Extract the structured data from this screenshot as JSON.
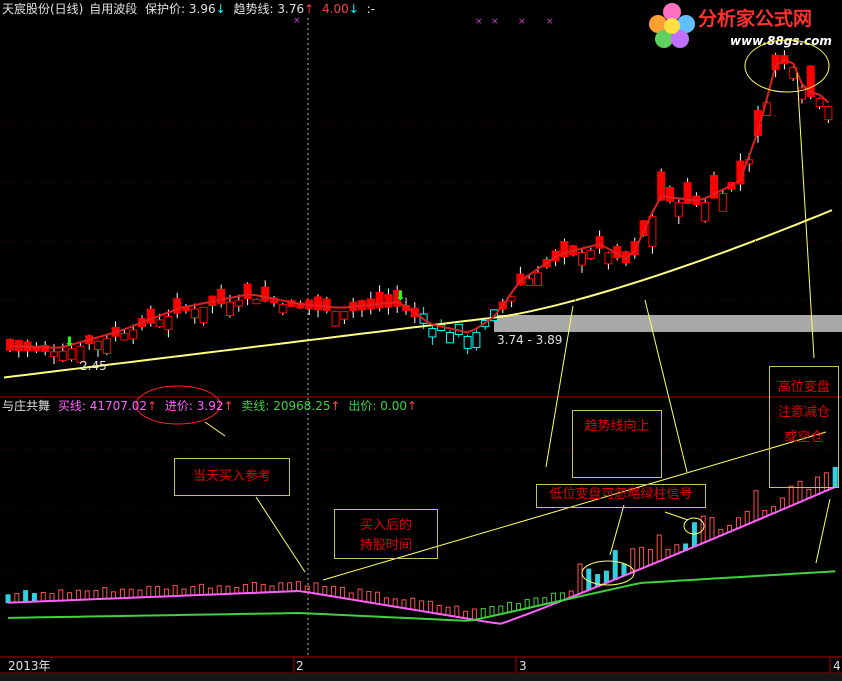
{
  "header": {
    "title": "天宸股份(日线)",
    "indicator_name": "自用波段",
    "protect_label": "保护价:",
    "protect_value": "3.96",
    "trend_label": "趋势线:",
    "trend_value": "3.76",
    "extra_value": "4.00",
    "extra_suffix": ":-"
  },
  "price_panel": {
    "min_label": "2.45",
    "range_label": "3.74 - 3.89"
  },
  "sub_header": {
    "name": "与庄共舞",
    "buy_label": "买线:",
    "buy_value": "41707.02",
    "enter_label": "进价:",
    "enter_value": "3.92",
    "sell_label": "卖线:",
    "sell_value": "20968.25",
    "exit_label": "出价:",
    "exit_value": "0.00"
  },
  "x_axis": {
    "year_label": "2013年",
    "month2": "2",
    "month3": "3",
    "month4": "4"
  },
  "annotations": {
    "buy_ref": "当天买入参考",
    "hold_line1": "买入后的",
    "hold_line2": "持股时间",
    "trend_up": "趋势线向上",
    "low_change": "低位变盘可忽略绿柱信号",
    "high_line1": "高位变盘",
    "high_line2": "注意减仓",
    "high_line3": "或空仓"
  },
  "logo": {
    "name": "分析家公式网",
    "url": "www.88gs.com"
  },
  "colors": {
    "up": "#ff0000",
    "down": "#00ffff",
    "ma_red": "#e02020",
    "ma_yellow": "#ffff80",
    "buy_line": "#ff60ff",
    "sell_line": "#40d040",
    "note_border": "#c8c060"
  }
}
